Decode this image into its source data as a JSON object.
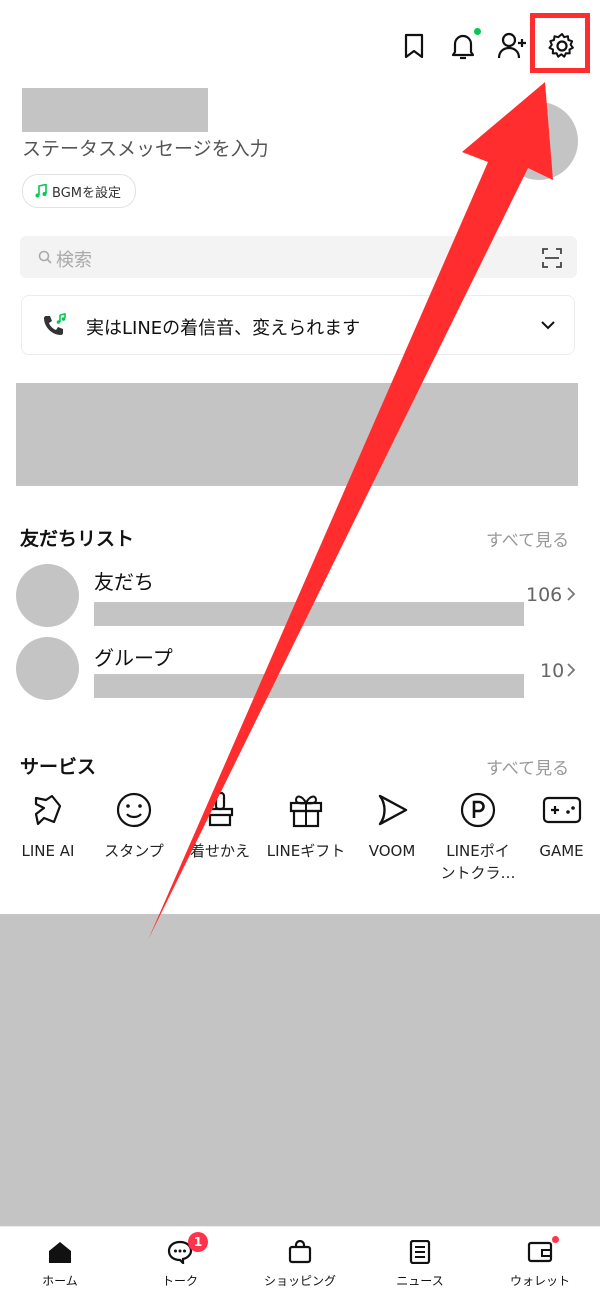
{
  "profile": {
    "status_message": "ステータスメッセージを入力",
    "bgm_label": "BGMを設定"
  },
  "search": {
    "placeholder": "検索"
  },
  "banner": {
    "text": "実はLINEの着信音、変えられます"
  },
  "friends": {
    "title": "友だちリスト",
    "see_all": "すべて見る",
    "items": [
      {
        "label": "友だち",
        "count": "106"
      },
      {
        "label": "グループ",
        "count": "10"
      }
    ]
  },
  "services": {
    "title": "サービス",
    "see_all": "すべて見る",
    "items": [
      {
        "label": "LINE AI",
        "icon": "line-ai-icon"
      },
      {
        "label": "スタンプ",
        "icon": "smile-icon"
      },
      {
        "label": "着せかえ",
        "icon": "brush-icon"
      },
      {
        "label": "LINEギフト",
        "icon": "gift-icon"
      },
      {
        "label": "VOOM",
        "icon": "play-icon"
      },
      {
        "label": "LINEポイントクラ…",
        "icon": "point-icon"
      },
      {
        "label": "GAME",
        "icon": "game-icon"
      }
    ]
  },
  "bottom_nav": [
    {
      "label": "ホーム",
      "icon": "home-icon"
    },
    {
      "label": "トーク",
      "icon": "chat-icon",
      "badge": "1"
    },
    {
      "label": "ショッピング",
      "icon": "shopping-bag-icon"
    },
    {
      "label": "ニュース",
      "icon": "news-icon"
    },
    {
      "label": "ウォレット",
      "icon": "wallet-icon"
    }
  ],
  "colors": {
    "accent_green": "#06c755",
    "alert_red": "#ff334b",
    "annotation_red": "#ff2d2d"
  }
}
